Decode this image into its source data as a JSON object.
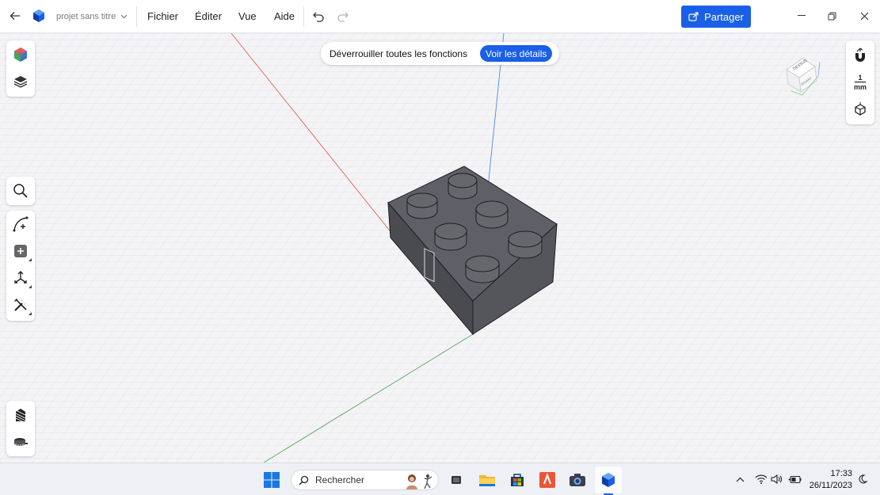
{
  "titlebar": {
    "project_name": "projet sans titre",
    "menu": [
      "Fichier",
      "Éditer",
      "Vue",
      "Aide"
    ],
    "share_label": "Partager"
  },
  "banner": {
    "text": "Déverrouiller toutes les fonctions",
    "button": "Voir les détails"
  },
  "right_panel": {
    "scale_value": "1",
    "scale_unit": "mm"
  },
  "viewcube": {
    "face_label": "DESSUS",
    "side_label": "DEVANT"
  },
  "taskbar": {
    "search_placeholder": "Rechercher",
    "time": "17:33",
    "date": "26/11/2023"
  },
  "colors": {
    "accent": "#1a5fe8",
    "x_axis": "#e0625a",
    "y_axis": "#5a9a5a",
    "z_axis": "#4a8ae8",
    "brick": "#5f6067"
  }
}
